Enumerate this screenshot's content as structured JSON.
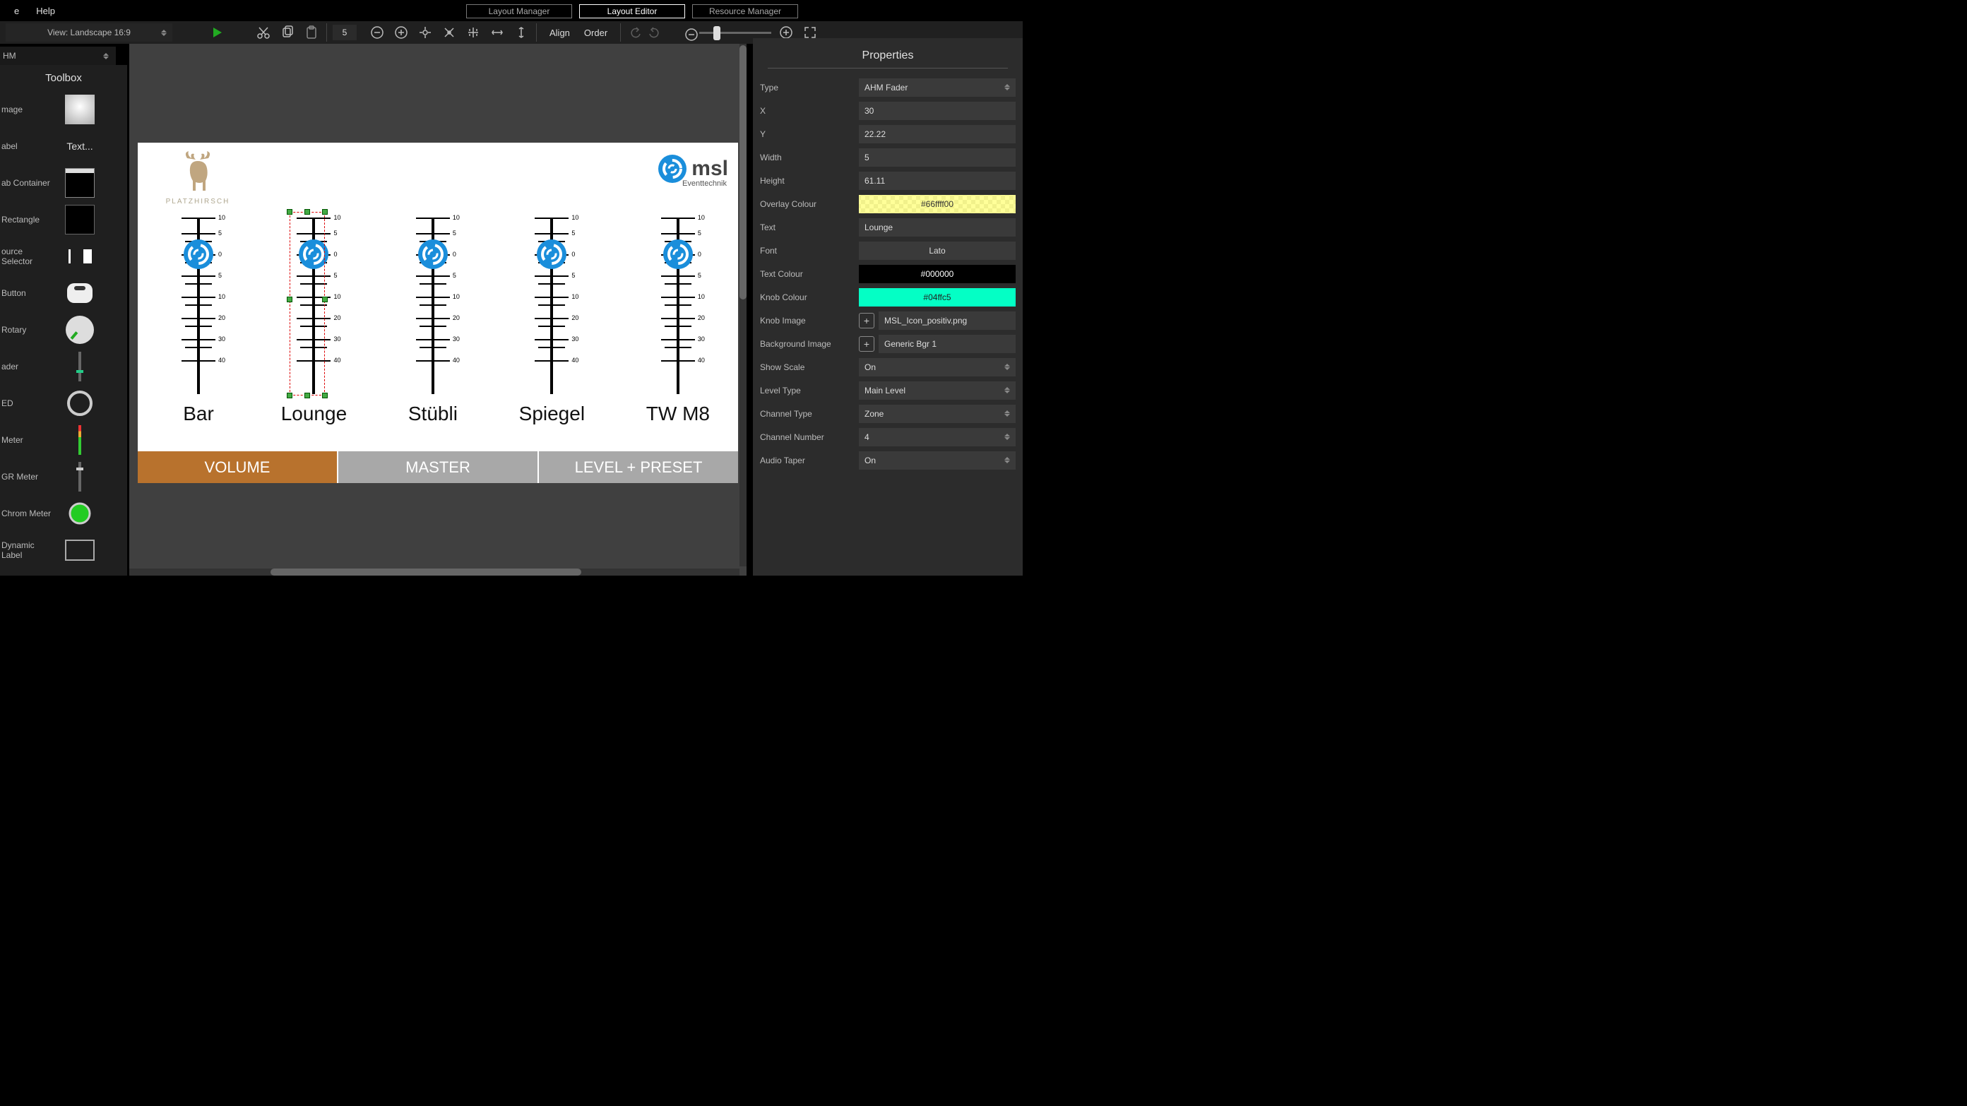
{
  "menu": {
    "e": "e",
    "help": "Help"
  },
  "topTabs": {
    "layoutManager": "Layout Manager",
    "layoutEditor": "Layout Editor",
    "resourceManager": "Resource Manager"
  },
  "toolbar": {
    "viewLabel": "View: Landscape 16:9",
    "numVal": "5",
    "align": "Align",
    "order": "Order"
  },
  "ahm": {
    "label": "HM"
  },
  "toolbox": {
    "title": "Toolbox",
    "items": [
      {
        "label": "mage"
      },
      {
        "label": "abel"
      },
      {
        "label": "ab Container"
      },
      {
        "label": "Rectangle"
      },
      {
        "label": "ource Selector"
      },
      {
        "label": "Button"
      },
      {
        "label": "Rotary"
      },
      {
        "label": "ader"
      },
      {
        "label": "ED"
      },
      {
        "label": "Meter"
      },
      {
        "label": "GR Meter"
      },
      {
        "label": "Chrom Meter"
      },
      {
        "label": "Dynamic Label"
      }
    ],
    "textLabel": "Text..."
  },
  "preview": {
    "logoLeft": "PLATZHIRSCH",
    "logoRight": "msl",
    "logoRightSub": "Eventtechnik",
    "faders": [
      "Bar",
      "Lounge",
      "Stübli",
      "Spiegel",
      "TW M8"
    ],
    "tabs": [
      "VOLUME",
      "MASTER",
      "LEVEL + PRESET"
    ],
    "ticks": [
      "10",
      "5",
      "0",
      "5",
      "10",
      "20",
      "30",
      "40"
    ]
  },
  "props": {
    "title": "Properties",
    "rows": [
      {
        "label": "Type",
        "value": "AHM Fader",
        "kind": "select"
      },
      {
        "label": "X",
        "value": "30",
        "kind": "text"
      },
      {
        "label": "Y",
        "value": "22.22",
        "kind": "text"
      },
      {
        "label": "Width",
        "value": "5",
        "kind": "text"
      },
      {
        "label": "Height",
        "value": "61.11",
        "kind": "text"
      },
      {
        "label": "Overlay Colour",
        "value": "#66ffff00",
        "kind": "overlay"
      },
      {
        "label": "Text",
        "value": "Lounge",
        "kind": "text"
      },
      {
        "label": "Font",
        "value": "Lato",
        "kind": "center"
      },
      {
        "label": "Text Colour",
        "value": "#000000",
        "kind": "textcol"
      },
      {
        "label": "Knob Colour",
        "value": "#04ffc5",
        "kind": "knobcol"
      },
      {
        "label": "Knob Image",
        "value": "MSL_Icon_positiv.png",
        "kind": "add"
      },
      {
        "label": "Background Image",
        "value": "Generic Bgr 1",
        "kind": "add"
      },
      {
        "label": "Show Scale",
        "value": "On",
        "kind": "select"
      },
      {
        "label": "Level Type",
        "value": "Main Level",
        "kind": "select"
      },
      {
        "label": "Channel Type",
        "value": "Zone",
        "kind": "select"
      },
      {
        "label": "Channel Number",
        "value": "4",
        "kind": "select"
      },
      {
        "label": "Audio Taper",
        "value": "On",
        "kind": "select"
      }
    ]
  }
}
